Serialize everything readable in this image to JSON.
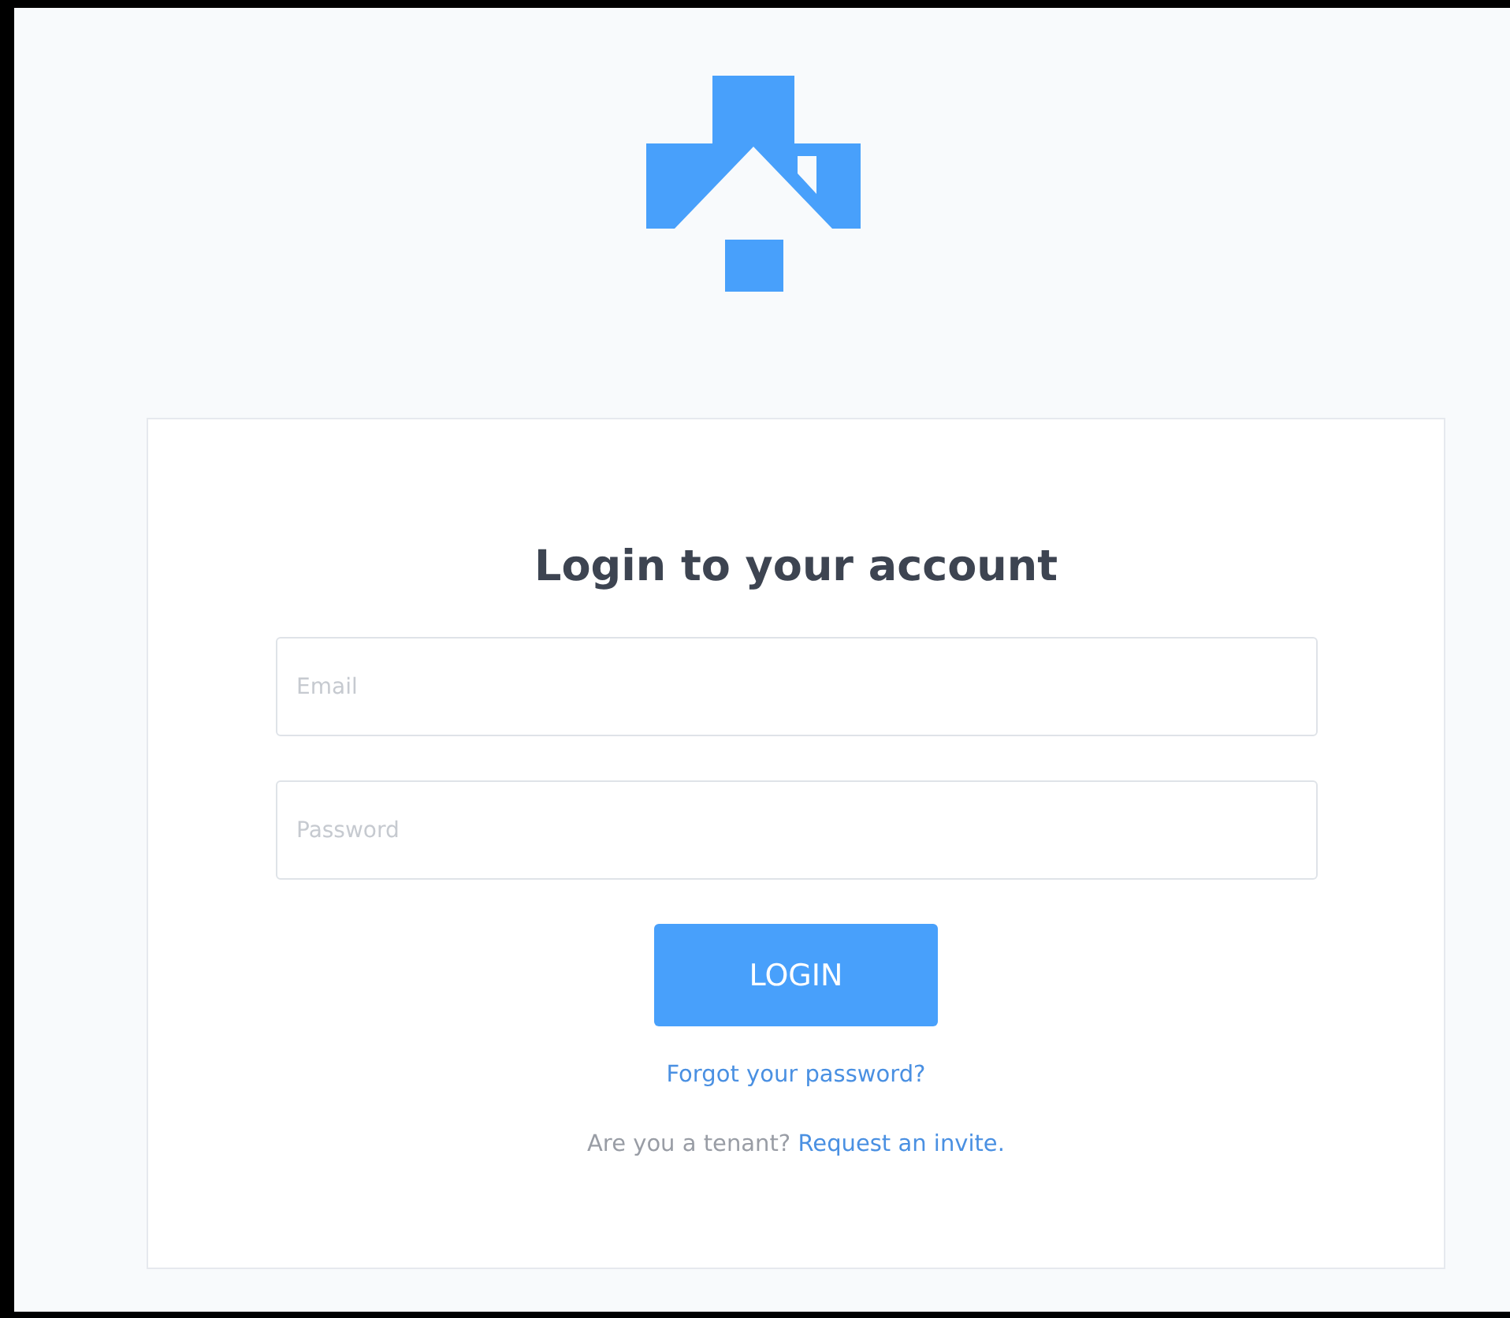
{
  "login_card": {
    "title": "Login to your account",
    "fields": [
      {
        "placeholder": "Email"
      },
      {
        "placeholder": "Password"
      }
    ],
    "submit_button": "LOGIN",
    "forgot_link": "Forgot your password?",
    "invite": {
      "prompt": "Are you a tenant?",
      "link": "Request an invite."
    }
  }
}
